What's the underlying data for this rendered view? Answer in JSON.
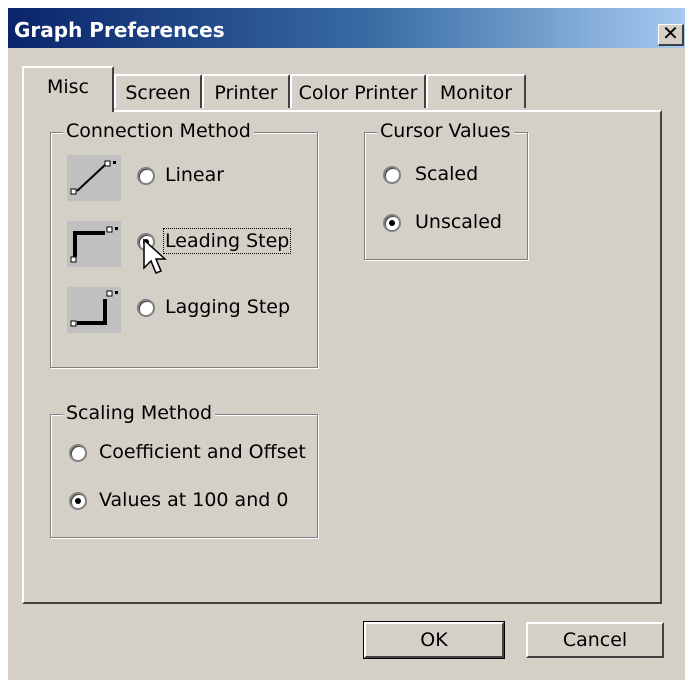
{
  "window": {
    "title": "Graph Preferences",
    "close_glyph": "✕"
  },
  "tabs": [
    {
      "label": "Misc",
      "active": true
    },
    {
      "label": "Screen"
    },
    {
      "label": "Printer"
    },
    {
      "label": "Color Printer"
    },
    {
      "label": "Monitor"
    }
  ],
  "connection_method": {
    "legend": "Connection Method",
    "options": [
      {
        "label": "Linear",
        "selected": false,
        "icon": "linear-connection-icon"
      },
      {
        "label": "Leading Step",
        "selected": true,
        "icon": "leading-step-icon"
      },
      {
        "label": "Lagging Step",
        "selected": false,
        "icon": "lagging-step-icon"
      }
    ]
  },
  "cursor_values": {
    "legend": "Cursor Values",
    "options": [
      {
        "label": "Scaled",
        "selected": false
      },
      {
        "label": "Unscaled",
        "selected": true
      }
    ]
  },
  "scaling_method": {
    "legend": "Scaling Method",
    "options": [
      {
        "label": "Coefficient and Offset",
        "selected": false
      },
      {
        "label": "Values at 100 and 0",
        "selected": true
      }
    ]
  },
  "buttons": {
    "ok": "OK",
    "cancel": "Cancel"
  },
  "colors": {
    "face": "#d4d0c8",
    "title_start": "#0a246a",
    "title_end": "#a6caf0"
  }
}
